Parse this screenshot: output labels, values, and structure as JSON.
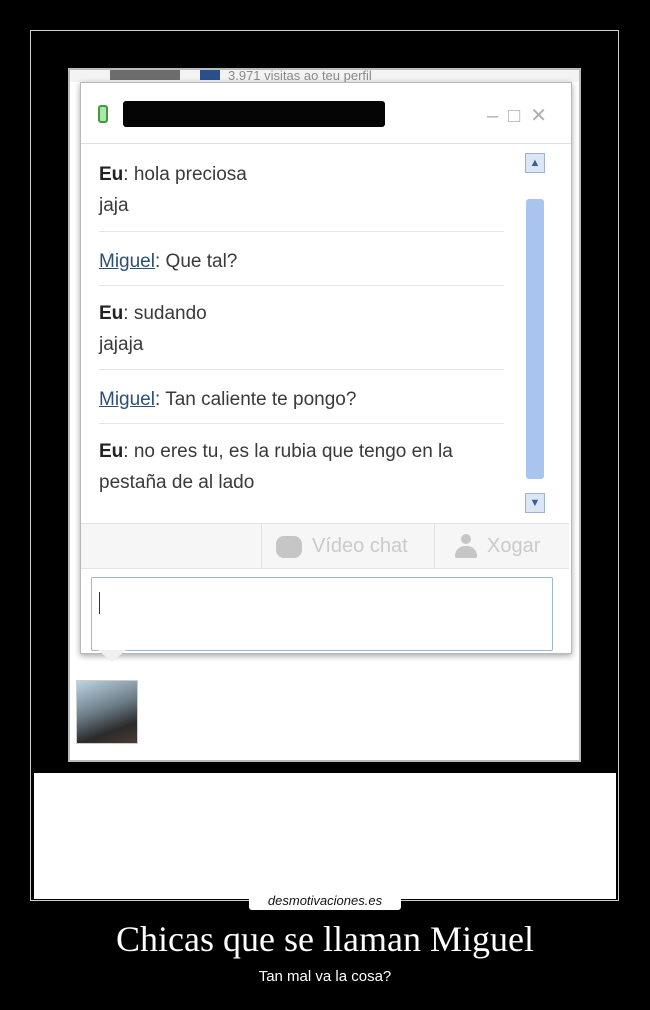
{
  "background_strip": {
    "text": "3.971 visitas ao teu perfil"
  },
  "chat": {
    "video_chat_label": "Vídeo chat",
    "play_label": "Xogar",
    "messages": [
      {
        "sender": "Eu",
        "text": "hola preciosa",
        "extra": "jaja"
      },
      {
        "sender": "Miguel",
        "text": "Que tal?"
      },
      {
        "sender": "Eu",
        "text": "sudando",
        "extra": "jajaja"
      },
      {
        "sender": "Miguel",
        "text": "Tan caliente te pongo?"
      },
      {
        "sender": "Eu",
        "text": "no eres tu, es la rubia que tengo en la",
        "extra": "pestaña de al lado"
      }
    ]
  },
  "poster": {
    "brand": "desmotivaciones.es",
    "title": "Chicas que se llaman Miguel",
    "subtitle": "Tan mal va la cosa?"
  }
}
